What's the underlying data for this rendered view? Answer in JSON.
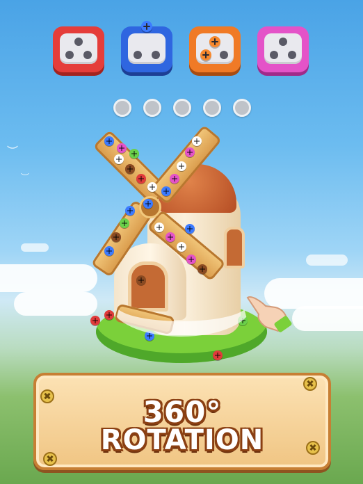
{
  "banner": {
    "line1": "360°",
    "line2": "ROTATION"
  },
  "boxes": [
    {
      "color": "#e53d3a",
      "label": "red-box"
    },
    {
      "color": "#2f66e0",
      "label": "blue-box"
    },
    {
      "color": "#f07a26",
      "label": "orange-box"
    },
    {
      "color": "#e453c8",
      "label": "pink-box"
    }
  ],
  "slots": {
    "count": 5,
    "filled": 0
  },
  "icons": [
    "screw-icon",
    "windmill",
    "hand-pointer-icon",
    "rotate-arrow-icon"
  ],
  "colors": {
    "sky": "#4aa3e6",
    "grass": "#7bd03a",
    "banner": "#f0c583",
    "banner_text": "#ffffff"
  }
}
